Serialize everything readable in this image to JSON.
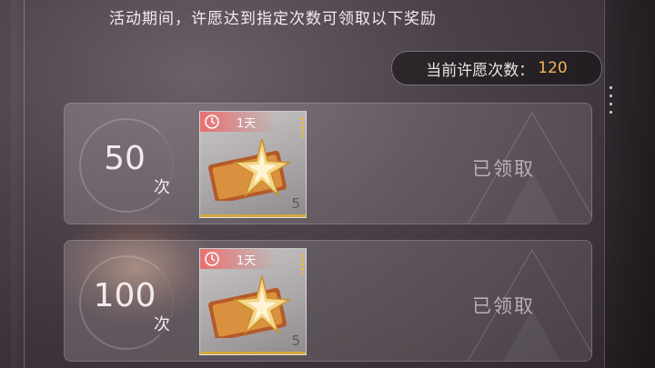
{
  "header": {
    "text": "活动期间，许愿达到指定次数可领取以下奖励"
  },
  "wish_count": {
    "label": "当前许愿次数：",
    "value": "120"
  },
  "rewards": [
    {
      "threshold": "50",
      "unit": "次",
      "timer_label": "1天",
      "item_count": "5",
      "status": "已领取"
    },
    {
      "threshold": "100",
      "unit": "次",
      "timer_label": "1天",
      "item_count": "5",
      "status": "已领取"
    }
  ],
  "colors": {
    "accent": "#f3b35a",
    "timer_tag": "#e86f6f"
  },
  "icons": {
    "timer": "clock-icon",
    "item": "star-ticket-icon"
  }
}
